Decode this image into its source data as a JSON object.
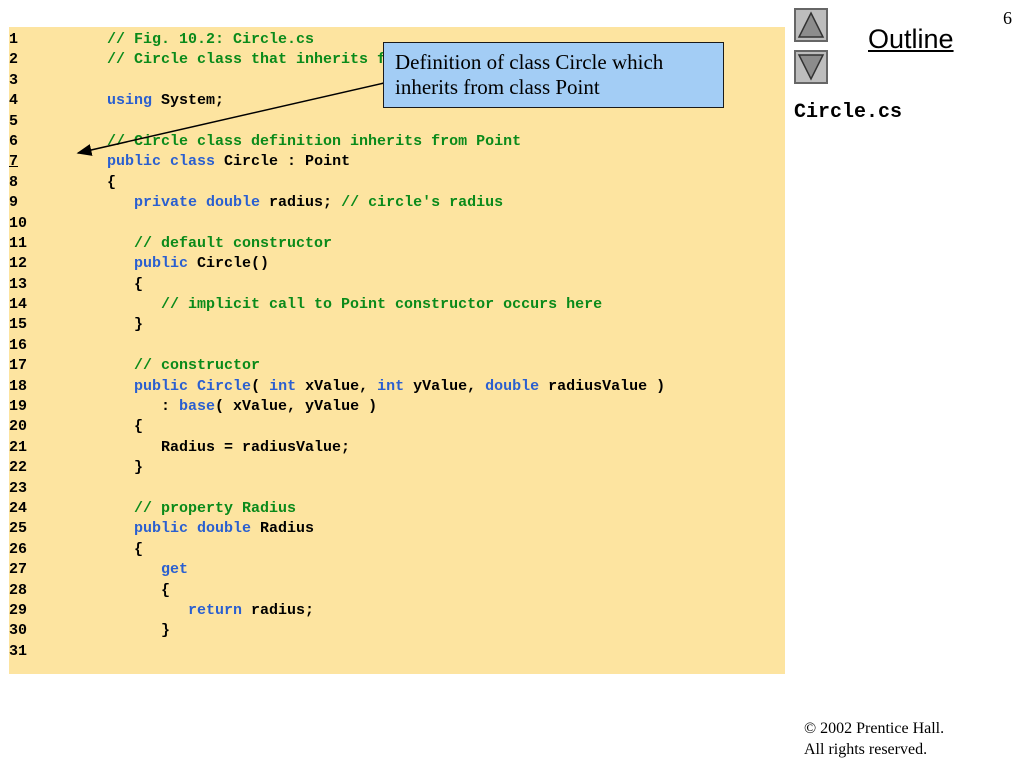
{
  "slide": {
    "page_number": "6",
    "outline_label": "Outline",
    "file_name": "Circle.cs",
    "copyright_line1": "© 2002 Prentice Hall.",
    "copyright_line2": "All rights reserved.",
    "callout_text": "Definition of class Circle which inherits from class Point"
  },
  "nav": {
    "up_icon": "triangle-up-icon",
    "down_icon": "triangle-down-icon"
  },
  "colors": {
    "code_background": "#fde4a0",
    "comment": "#0a8a1a",
    "keyword": "#2a5fd0",
    "callout_background": "#a3cdf5"
  },
  "code": {
    "lines": [
      {
        "num": "1",
        "tokens": [
          {
            "t": "    ",
            "c": "plain"
          },
          {
            "t": "// Fig. 10.2: Circle.cs",
            "c": "comment"
          }
        ]
      },
      {
        "num": "2",
        "tokens": [
          {
            "t": "    ",
            "c": "plain"
          },
          {
            "t": "// Circle class that inherits from class Point.",
            "c": "comment"
          }
        ]
      },
      {
        "num": "3",
        "tokens": []
      },
      {
        "num": "4",
        "tokens": [
          {
            "t": "    ",
            "c": "plain"
          },
          {
            "t": "using",
            "c": "keyword"
          },
          {
            "t": " System;",
            "c": "plain"
          }
        ]
      },
      {
        "num": "5",
        "tokens": []
      },
      {
        "num": "6",
        "tokens": [
          {
            "t": "    ",
            "c": "plain"
          },
          {
            "t": "// Circle class definition inherits from Point",
            "c": "comment"
          }
        ]
      },
      {
        "num": "7",
        "underline": true,
        "tokens": [
          {
            "t": "    ",
            "c": "plain"
          },
          {
            "t": "public class",
            "c": "keyword"
          },
          {
            "t": " Circle : Point",
            "c": "plain"
          }
        ]
      },
      {
        "num": "8",
        "tokens": [
          {
            "t": "    {",
            "c": "plain"
          }
        ]
      },
      {
        "num": "9",
        "tokens": [
          {
            "t": "       ",
            "c": "plain"
          },
          {
            "t": "private double",
            "c": "keyword"
          },
          {
            "t": " radius; ",
            "c": "plain"
          },
          {
            "t": "// circle's radius",
            "c": "comment"
          }
        ]
      },
      {
        "num": "10",
        "tokens": []
      },
      {
        "num": "11",
        "tokens": [
          {
            "t": "       ",
            "c": "plain"
          },
          {
            "t": "// default constructor",
            "c": "comment"
          }
        ]
      },
      {
        "num": "12",
        "tokens": [
          {
            "t": "       ",
            "c": "plain"
          },
          {
            "t": "public",
            "c": "keyword"
          },
          {
            "t": " Circle()",
            "c": "plain"
          }
        ]
      },
      {
        "num": "13",
        "tokens": [
          {
            "t": "       {",
            "c": "plain"
          }
        ]
      },
      {
        "num": "14",
        "tokens": [
          {
            "t": "          ",
            "c": "plain"
          },
          {
            "t": "// implicit call to Point constructor occurs here",
            "c": "comment"
          }
        ]
      },
      {
        "num": "15",
        "tokens": [
          {
            "t": "       }",
            "c": "plain"
          }
        ]
      },
      {
        "num": "16",
        "tokens": []
      },
      {
        "num": "17",
        "tokens": [
          {
            "t": "       ",
            "c": "plain"
          },
          {
            "t": "// constructor",
            "c": "comment"
          }
        ]
      },
      {
        "num": "18",
        "tokens": [
          {
            "t": "       ",
            "c": "plain"
          },
          {
            "t": "public",
            "c": "keyword"
          },
          {
            "t": " ",
            "c": "plain"
          },
          {
            "t": "Circle",
            "c": "keyword"
          },
          {
            "t": "( ",
            "c": "plain"
          },
          {
            "t": "int",
            "c": "keyword"
          },
          {
            "t": " xValue, ",
            "c": "plain"
          },
          {
            "t": "int",
            "c": "keyword"
          },
          {
            "t": " yValue, ",
            "c": "plain"
          },
          {
            "t": "double",
            "c": "keyword"
          },
          {
            "t": " radiusValue )",
            "c": "plain"
          }
        ]
      },
      {
        "num": "19",
        "tokens": [
          {
            "t": "          : ",
            "c": "plain"
          },
          {
            "t": "base",
            "c": "keyword"
          },
          {
            "t": "( xValue, yValue )",
            "c": "plain"
          }
        ]
      },
      {
        "num": "20",
        "tokens": [
          {
            "t": "       {",
            "c": "plain"
          }
        ]
      },
      {
        "num": "21",
        "tokens": [
          {
            "t": "          Radius = radiusValue;",
            "c": "plain"
          }
        ]
      },
      {
        "num": "22",
        "tokens": [
          {
            "t": "       }",
            "c": "plain"
          }
        ]
      },
      {
        "num": "23",
        "tokens": []
      },
      {
        "num": "24",
        "tokens": [
          {
            "t": "       ",
            "c": "plain"
          },
          {
            "t": "// property Radius",
            "c": "comment"
          }
        ]
      },
      {
        "num": "25",
        "tokens": [
          {
            "t": "       ",
            "c": "plain"
          },
          {
            "t": "public double",
            "c": "keyword"
          },
          {
            "t": " Radius",
            "c": "plain"
          }
        ]
      },
      {
        "num": "26",
        "tokens": [
          {
            "t": "       {",
            "c": "plain"
          }
        ]
      },
      {
        "num": "27",
        "tokens": [
          {
            "t": "          ",
            "c": "plain"
          },
          {
            "t": "get",
            "c": "keyword"
          }
        ]
      },
      {
        "num": "28",
        "tokens": [
          {
            "t": "          {",
            "c": "plain"
          }
        ]
      },
      {
        "num": "29",
        "tokens": [
          {
            "t": "             ",
            "c": "plain"
          },
          {
            "t": "return",
            "c": "keyword"
          },
          {
            "t": " radius;",
            "c": "plain"
          }
        ]
      },
      {
        "num": "30",
        "tokens": [
          {
            "t": "          }",
            "c": "plain"
          }
        ]
      },
      {
        "num": "31",
        "tokens": []
      }
    ]
  }
}
